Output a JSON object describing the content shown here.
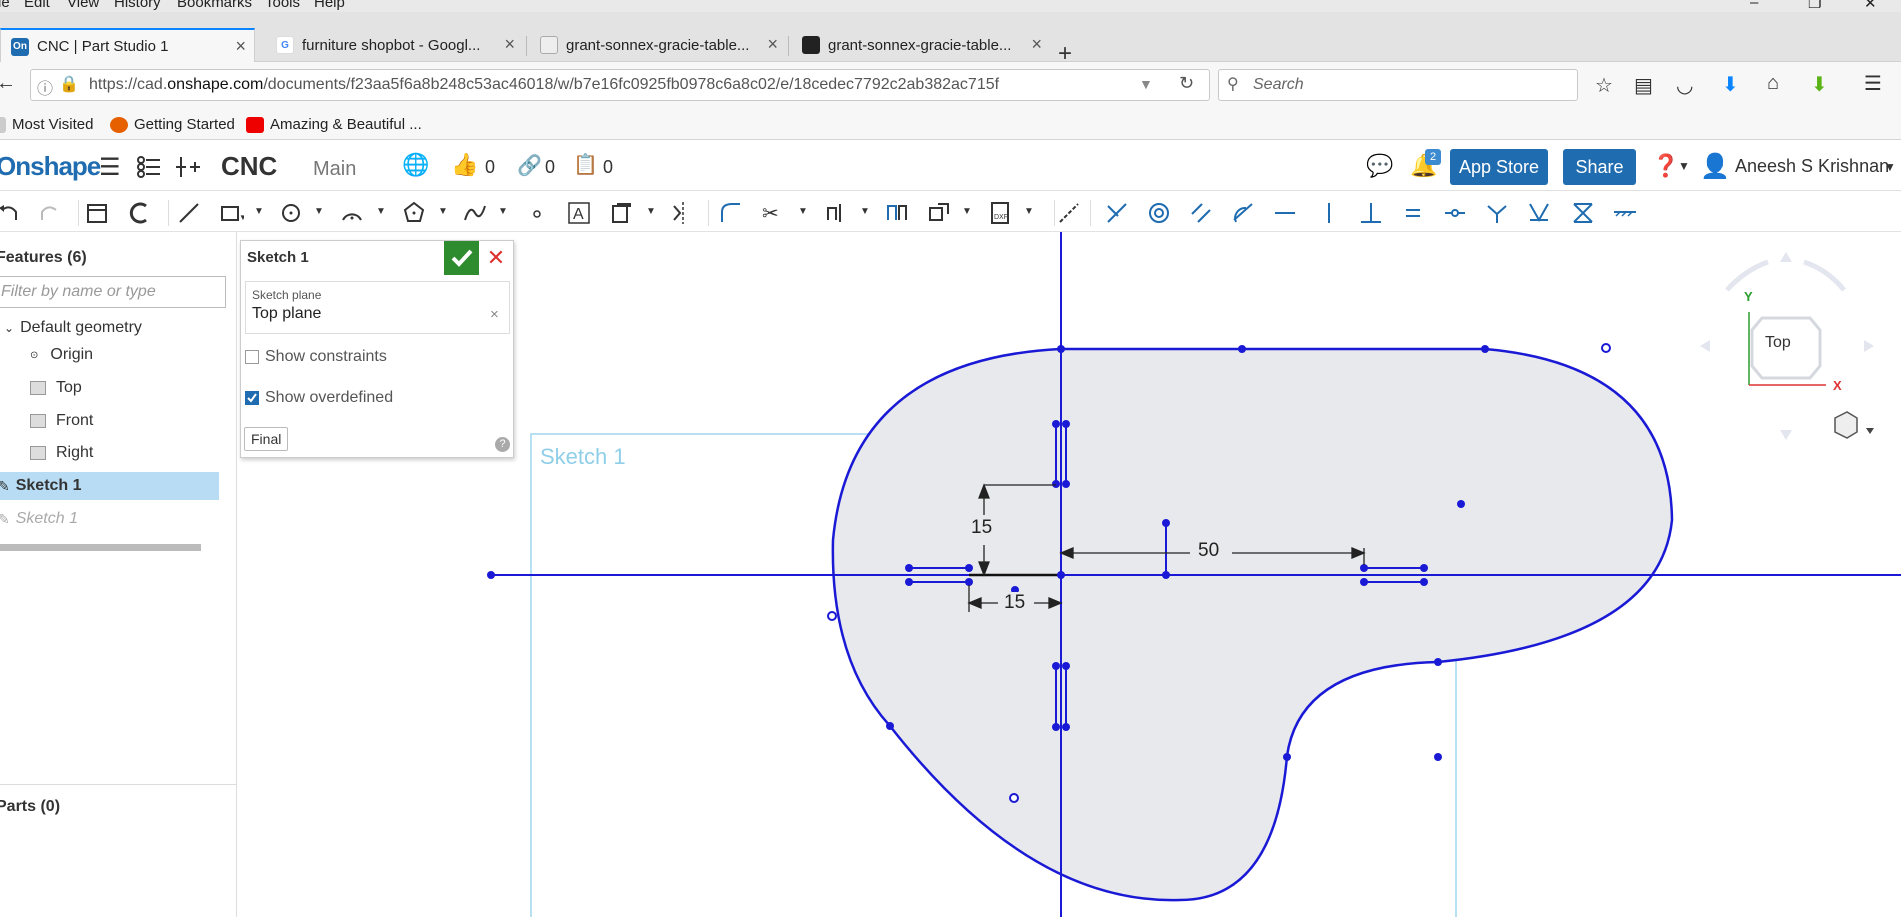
{
  "browser": {
    "menu": [
      "le",
      "Edit",
      "View",
      "History",
      "Bookmarks",
      "Tools",
      "Help"
    ],
    "tabs": [
      {
        "title": "CNC | Part Studio 1",
        "favicon": "onshape-icon",
        "active": true
      },
      {
        "title": "furniture shopbot - Googl...",
        "favicon": "google-icon",
        "active": false
      },
      {
        "title": "grant-sonnex-gracie-table...",
        "favicon": "page-icon",
        "active": false
      },
      {
        "title": "grant-sonnex-gracie-table...",
        "favicon": "image-icon",
        "active": false
      }
    ],
    "url_prefix": "https://cad.",
    "url_host": "onshape.com",
    "url_rest": "/documents/f23aa5f6a8b248c53ac46018/w/b7e16fc0925fb0978c6a8c02/e/18cedec7792c2ab382ac715f",
    "search_placeholder": "Search",
    "bookmarks": [
      "Most Visited",
      "Getting Started",
      "Amazing & Beautiful ..."
    ]
  },
  "onshape": {
    "logo": "Onshape",
    "document": "CNC",
    "workspace": "Main",
    "likes": "0",
    "links": "0",
    "copies": "0",
    "notifications": "2",
    "app_store": "App Store",
    "share": "Share",
    "user": "Aneesh S Krishnan"
  },
  "features": {
    "title": "Features (6)",
    "filter_placeholder": "Filter by name or type",
    "group": "Default geometry",
    "items": [
      "Origin",
      "Top",
      "Front",
      "Right"
    ],
    "selected": "Sketch 1",
    "rollback": "Sketch 1",
    "parts": "Parts (0)"
  },
  "dialog": {
    "title": "Sketch 1",
    "plane_label": "Sketch plane",
    "plane_value": "Top plane",
    "show_constraints": "Show constraints",
    "show_constraints_checked": false,
    "show_overdefined": "Show overdefined",
    "show_overdefined_checked": true,
    "final": "Final"
  },
  "canvas": {
    "sketch_label": "Sketch 1",
    "dim_vertical": "15",
    "dim_horizontal_small": "15",
    "dim_horizontal_large": "50",
    "view_cube": "Top",
    "axis_y": "Y",
    "axis_x": "X"
  },
  "colors": {
    "sketch": "#1a1ad6",
    "accent": "#1f6cb0",
    "selected": "#b7dcf4",
    "ok": "#2e8b2e"
  }
}
